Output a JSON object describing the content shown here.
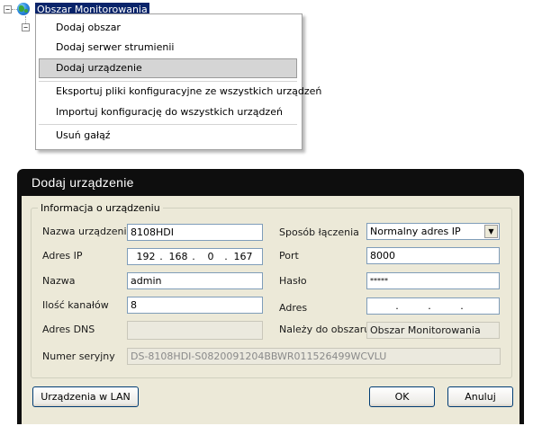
{
  "tree": {
    "root_label": "Obszar Monitorowania",
    "expander_symbol": "−",
    "root_icon": "globe-icon"
  },
  "context_menu": {
    "items": [
      {
        "label": "Dodaj obszar"
      },
      {
        "label": "Dodaj serwer strumienii"
      },
      {
        "label": "Dodaj urządzenie",
        "highlighted": true
      },
      {
        "label": "Eksportuj pliki konfiguracyjne ze wszystkich urządzeń"
      },
      {
        "label": "Importuj konfigurację do wszystkich urządzeń"
      },
      {
        "label": "Usuń gałąź"
      }
    ]
  },
  "dialog": {
    "title": "Dodaj urządzenie",
    "group_title": "Informacja o urządzeniu",
    "labels": {
      "device_name": "Nazwa urządzenia",
      "ip_address": "Adres IP",
      "username": "Nazwa",
      "channel_count": "Ilość kanałów",
      "dns_address": "Adres DNS",
      "serial_number": "Numer seryjny",
      "connection_mode": "Sposób łączenia",
      "port": "Port",
      "password": "Hasło",
      "address": "Adres",
      "belongs_to_area": "Należy do obszaru"
    },
    "values": {
      "device_name": "8108HDI",
      "ip_octets": [
        "192",
        "168",
        "0",
        "167"
      ],
      "ip_separator": ".",
      "username": "admin",
      "channel_count": "8",
      "dns_address": "",
      "serial_number": "DS-8108HDI-S0820091204BBWR011526499WCVLU",
      "connection_mode": "Normalny adres IP",
      "port": "8000",
      "password": "*****",
      "address_separator": ".",
      "belongs_to_area": "Obszar Monitorowania"
    },
    "buttons": {
      "lan_devices": "Urządzenia w LAN",
      "ok": "OK",
      "cancel": "Anuluj"
    },
    "colors": {
      "title_bar": "#0e0e0e",
      "dialog_face": "#ece9d8",
      "selection": "#0a246a"
    }
  }
}
